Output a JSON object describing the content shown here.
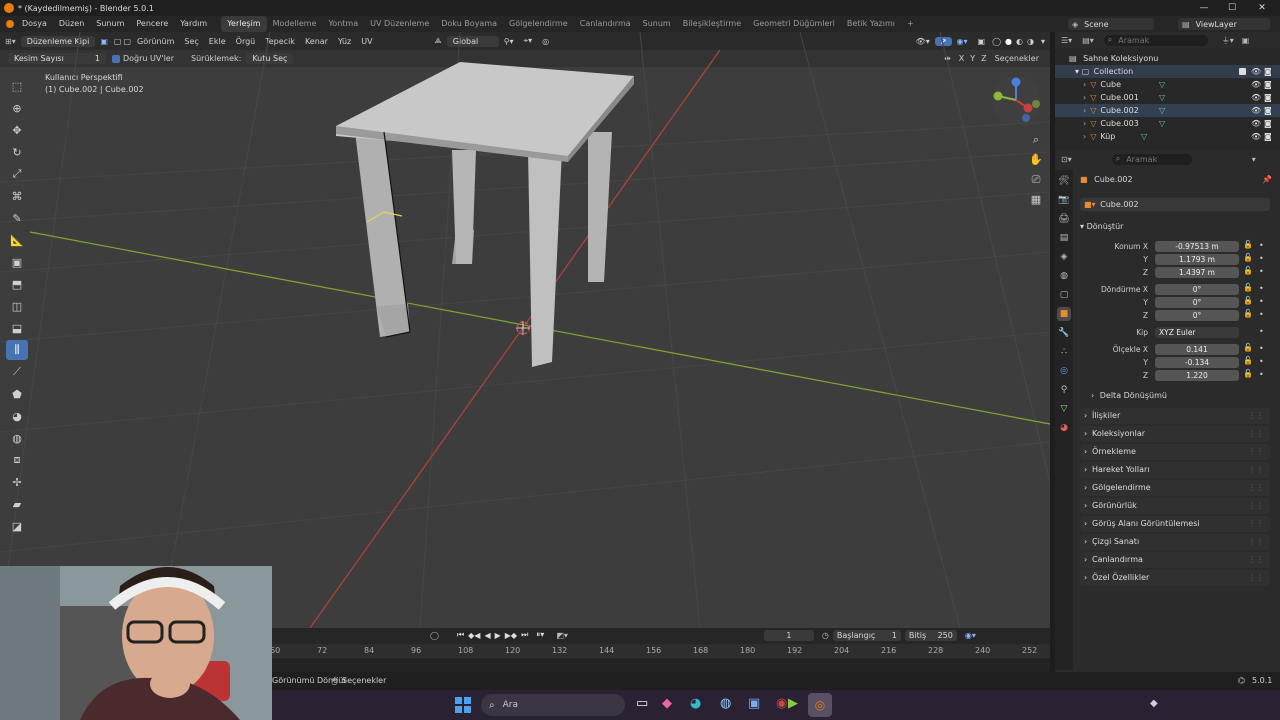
{
  "window": {
    "title": "* (Kaydedilmemiş) - Blender 5.0.1",
    "minimize": "—",
    "maximize": "☐",
    "close": "✕"
  },
  "menu": {
    "items": [
      "Dosya",
      "Düzen",
      "Sunum",
      "Pencere",
      "Yardım"
    ]
  },
  "workspaces": {
    "items": [
      "Yerleşim",
      "Modelleme",
      "Yontma",
      "UV Düzenleme",
      "Doku Boyama",
      "Gölgelendirme",
      "Canlandırma",
      "Sunum",
      "Bileşikleştirme",
      "Geometri Düğümleri",
      "Betik Yazımı"
    ],
    "active": "Yerleşim",
    "add": "+"
  },
  "scene": {
    "label": "Scene",
    "view_layer": "ViewLayer"
  },
  "viewport_header": {
    "mode": "Düzenleme Kipi",
    "menus": [
      "Görünüm",
      "Seç",
      "Ekle",
      "Örgü",
      "Tepecik",
      "Kenar",
      "Yüz",
      "UV"
    ],
    "orientation": "Global"
  },
  "tool_options": {
    "cuts_label": "Kesim Sayısı",
    "cuts_value": "1",
    "correct_uv": "Doğru UV'ler",
    "drag_label": "Sürüklemek:",
    "drag_value": "Kutu Seç",
    "axes": [
      "X",
      "Y",
      "Z"
    ],
    "options": "Seçenekler"
  },
  "overlay_text": {
    "perspective": "Kullanıcı Perspektifi",
    "object": "(1) Cube.002 | Cube.002"
  },
  "outliner": {
    "search_placeholder": "Aramak",
    "root": "Sahne Koleksiyonu",
    "collection": "Collection",
    "objects": [
      "Cube",
      "Cube.001",
      "Cube.002",
      "Cube.003",
      "Küp"
    ]
  },
  "properties": {
    "search_placeholder": "Aramak",
    "object_name": "Cube.002",
    "datablock": "Cube.002",
    "transform_header": "Dönüştür",
    "location_label": "Konum X",
    "location": [
      "-0.97513 m",
      "1.1793 m",
      "1.4397 m"
    ],
    "rotation_label": "Döndürme X",
    "rotation": [
      "0°",
      "0°",
      "0°"
    ],
    "mode_label": "Kip",
    "mode_value": "XYZ Euler",
    "scale_label": "Ölçekle X",
    "scale": [
      "0.141",
      "-0.134",
      "1.220"
    ],
    "axis_y": "Y",
    "axis_z": "Z",
    "delta": "Delta Dönüşümü",
    "sections": [
      "İlişkiler",
      "Koleksiyonlar",
      "Örnekleme",
      "Hareket Yolları",
      "Gölgelendirme",
      "Görünürlük",
      "Görüş Alanı Görüntülemesi",
      "Çizgi Sanatı",
      "Canlandırma",
      "Özel Özellikler"
    ]
  },
  "timeline": {
    "current_frame": "1",
    "start_label": "Başlangıç",
    "start": "1",
    "end_label": "Bitiş",
    "end": "250",
    "ticks": [
      "60",
      "72",
      "84",
      "96",
      "108",
      "120",
      "132",
      "144",
      "156",
      "168",
      "180",
      "192",
      "204",
      "216",
      "228",
      "240",
      "252"
    ]
  },
  "statusbar": {
    "left": "Görünümü Döndür",
    "select": "Seçenekler",
    "version": "5.0.1"
  },
  "taskbar": {
    "search_placeholder": "Ara"
  },
  "colors": {
    "accent": "#4772b3",
    "x_axis": "#c84040",
    "y_axis": "#8fb83a",
    "z_axis": "#4a7ee0",
    "object_orange": "#e88c2c"
  }
}
